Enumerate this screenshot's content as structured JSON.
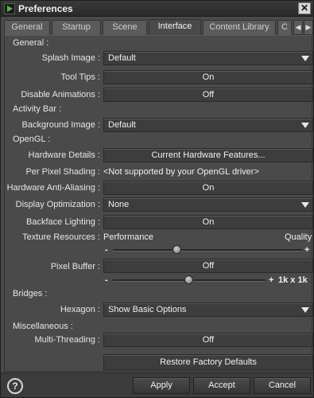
{
  "window": {
    "title": "Preferences",
    "close": "✕"
  },
  "tabs": [
    {
      "label": "General"
    },
    {
      "label": "Startup"
    },
    {
      "label": "Scene"
    },
    {
      "label": "Interface"
    },
    {
      "label": "Content Library"
    },
    {
      "label": "C"
    }
  ],
  "active_tab": "Interface",
  "tab_scroll": {
    "left": "◀",
    "right": "▶"
  },
  "sections": {
    "general": "General :",
    "activity_bar": "Activity Bar :",
    "opengl": "OpenGL :",
    "bridges": "Bridges :",
    "misc": "Miscellaneous :"
  },
  "fields": {
    "splash_image": {
      "label": "Splash Image :",
      "value": "Default"
    },
    "tool_tips": {
      "label": "Tool Tips :",
      "value": "On"
    },
    "disable_animations": {
      "label": "Disable Animations :",
      "value": "Off"
    },
    "background_image": {
      "label": "Background Image :",
      "value": "Default"
    },
    "hardware_details": {
      "label": "Hardware Details :",
      "value": "Current Hardware Features..."
    },
    "per_pixel_shading": {
      "label": "Per Pixel Shading :",
      "value": "<Not supported by your OpenGL driver>"
    },
    "hw_antialiasing": {
      "label": "Hardware Anti-Aliasing :",
      "value": "On"
    },
    "display_optimization": {
      "label": "Display Optimization :",
      "value": "None"
    },
    "backface_lighting": {
      "label": "Backface Lighting :",
      "value": "On"
    },
    "texture_resources": {
      "label": "Texture Resources :",
      "left": "Performance",
      "right": "Quality",
      "minus": "-",
      "plus": "+",
      "level": 0.34
    },
    "pixel_buffer": {
      "label": "Pixel Buffer :",
      "value": "Off",
      "minus": "-",
      "plus": "+",
      "size": "1k x 1k",
      "level": 0.5
    },
    "hexagon": {
      "label": "Hexagon :",
      "value": "Show Basic Options"
    },
    "multi_threading": {
      "label": "Multi-Threading :",
      "value": "Off"
    },
    "restore": {
      "value": "Restore Factory Defaults"
    }
  },
  "footer": {
    "help": "?",
    "apply": "Apply",
    "accept": "Accept",
    "cancel": "Cancel"
  }
}
